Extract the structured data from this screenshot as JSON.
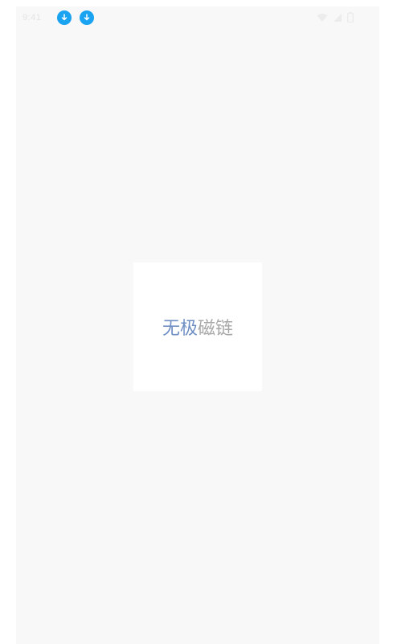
{
  "status_bar": {
    "time": "9:41",
    "notifications": [
      {
        "icon": "download-arrow-icon",
        "color": "#1aa3f0"
      },
      {
        "icon": "download-arrow-icon",
        "color": "#1aa3f0"
      }
    ],
    "system_icons": [
      "wifi-icon",
      "signal-icon",
      "battery-icon"
    ]
  },
  "splash": {
    "logo_part_a": "无极",
    "logo_part_b": "磁链",
    "logo_color_a": "#6f8fc4",
    "logo_color_b": "#a7a7a7"
  },
  "colors": {
    "background": "#f8f8f8",
    "card": "#ffffff",
    "notification_accent": "#1aa3f0"
  }
}
